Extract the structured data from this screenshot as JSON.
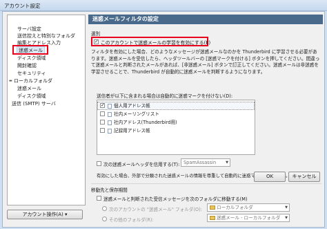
{
  "window": {
    "title": "アカウント設定"
  },
  "sidebar": {
    "items": [
      {
        "label": "サーバ設定"
      },
      {
        "label": "送信控えと特別なフォルダ"
      },
      {
        "label": "編集とアドレス入力"
      },
      {
        "label": "迷惑メール"
      },
      {
        "label": "ディスク領域"
      },
      {
        "label": "開封確認"
      },
      {
        "label": "セキュリティ"
      },
      {
        "label": "ローカルフォルダ"
      },
      {
        "label": "迷惑メール"
      },
      {
        "label": "ディスク領域"
      },
      {
        "label": "送信 (SMTP) サーバ"
      }
    ],
    "account_actions": "アカウント操作(A)"
  },
  "main": {
    "header": "迷惑メールフィルタの設定",
    "section_select": "選別",
    "enable_checkbox": {
      "label": "このアカウントで迷惑メールの学習を有効にする(E)",
      "checked": true
    },
    "description": "フィルタを有効にした場合、どのようなメッセージが迷惑メールなのかを Thunderbird に学習させる必要があります。迷惑メールを受信したら、ヘッダツールバーの [迷惑マークを付ける] ボタンを押してください。間違って迷惑メールと判断されたメールがあれば、[非迷惑メール] ボタンで訂正してください。迷惑メールは非迷惑を学習させることで、Thunderbird が自動的に迷惑メールを判断するようになります。",
    "whitelist_label": "送信者が以下に含まれる場合は自動的に迷惑マークを付けない(D):",
    "whitelist": [
      {
        "label": "個人用アドレス帳",
        "checked": true
      },
      {
        "label": "社内メーリングリスト",
        "checked": false
      },
      {
        "label": "社内アドレス(Thunderbird用)",
        "checked": false
      },
      {
        "label": "記録用アドレス帳",
        "checked": false
      }
    ],
    "header_trust": {
      "label": "次の迷惑メールヘッダを信用する(T):",
      "checked": false,
      "value": "SpamAssassin"
    },
    "header_trust_desc": "有効にした場合、外部で分類された迷惑メールの情報を尊重して自動的に迷惑マークを付けます。",
    "section_destination": "移動先と保存期間",
    "move_checkbox": {
      "label": "迷惑メールと判断された受信メッセージを次のフォルダに移動する(M)",
      "checked": false
    },
    "radio_account": {
      "label": "次のアカウントの \"迷惑メール\" フォルダ(O):",
      "value": "ローカルフォルダ"
    },
    "radio_other": {
      "label": "その他のフォルダ(R):",
      "value": "迷惑メール - ローカルフォルダ"
    }
  },
  "buttons": {
    "ok": "OK",
    "cancel": "キャンセル"
  },
  "colors": {
    "highlight": "#e8001c",
    "header_bg": "#4a6a8c"
  }
}
